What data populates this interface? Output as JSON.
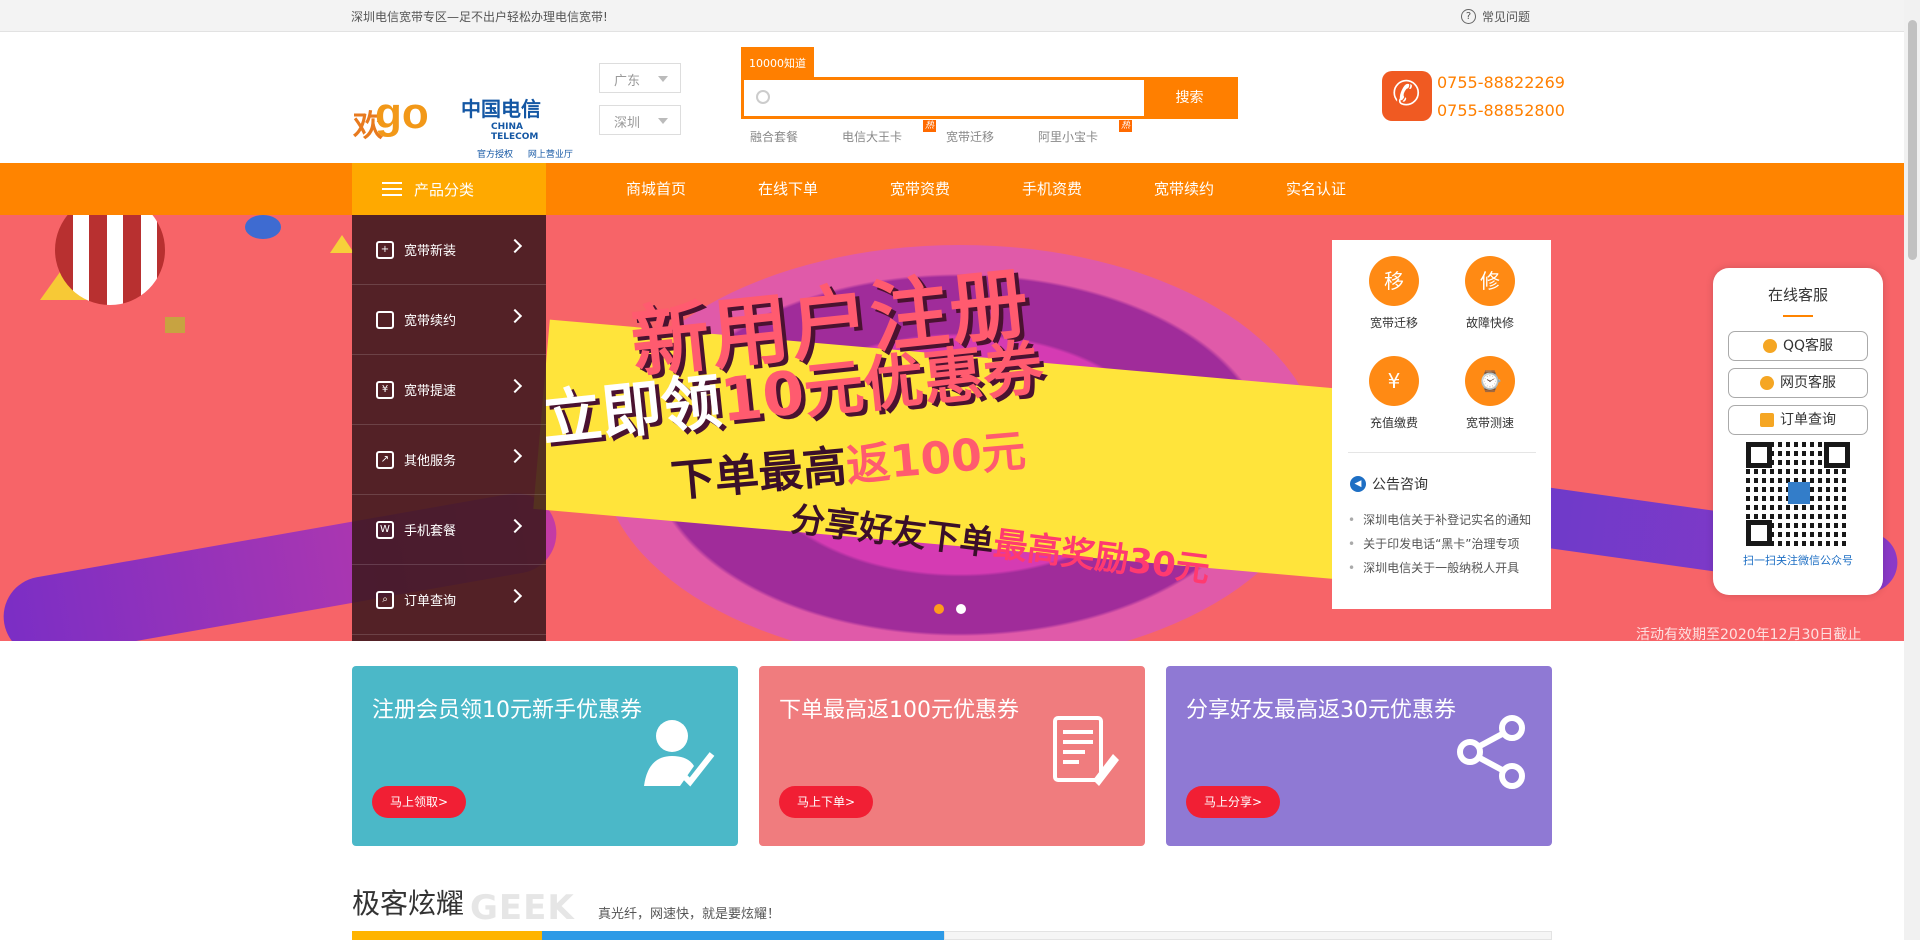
{
  "topbar": {
    "slogan": "深圳电信宽带专区—足不出户轻松办理电信宽带!",
    "faq": "常见问题"
  },
  "logo": {
    "huan": "欢",
    "go": "go",
    "brand_cn": "中国电信",
    "brand_en": "CHINA TELECOM",
    "sub": "官方授权 网上营业厅"
  },
  "location": {
    "province": "广东",
    "city": "深圳"
  },
  "search": {
    "tag": "10000知道",
    "placeholder": "",
    "button": "搜索",
    "hotlinks": [
      {
        "label": "融合套餐",
        "hot": ""
      },
      {
        "label": "电信大王卡",
        "hot": "热"
      },
      {
        "label": "宽带迁移",
        "hot": ""
      },
      {
        "label": "阿里小宝卡",
        "hot": "热"
      }
    ]
  },
  "contact": {
    "phone1": "0755-88822269",
    "phone2": "0755-88852800"
  },
  "nav": {
    "category": "产品分类",
    "links": [
      "商城首页",
      "在线下单",
      "宽带资费",
      "手机资费",
      "宽带续约",
      "实名认证"
    ]
  },
  "categories": [
    {
      "label": "宽带新装",
      "icon": "user-add-icon"
    },
    {
      "label": "宽带续约",
      "icon": "mobile-icon"
    },
    {
      "label": "宽带提速",
      "icon": "money-bag-icon"
    },
    {
      "label": "其他服务",
      "icon": "rocket-icon"
    },
    {
      "label": "手机套餐",
      "icon": "w-icon"
    },
    {
      "label": "订单查询",
      "icon": "order-search-icon"
    }
  ],
  "banner": {
    "line1": "新用户注册",
    "line2a": "立即领",
    "line2b": "10元优惠券",
    "line3a": "下单最高",
    "line3b": "返100元",
    "line4a": "分享好友下单",
    "line4b": "最高奖励30元",
    "validity": "活动有效期至2020年12月30日截止",
    "slide_count": 2,
    "active_slide": 1
  },
  "services": [
    {
      "glyph": "移",
      "label": "宽带迁移"
    },
    {
      "glyph": "修",
      "label": "故障快修"
    },
    {
      "glyph": "¥",
      "label": "充值缴费"
    },
    {
      "glyph": "⌚",
      "label": "宽带测速"
    }
  ],
  "notice": {
    "title": "公告咨询",
    "items": [
      "深圳电信关于补登记实名的通知",
      "关于印发电话“黑卡”治理专项",
      "深圳电信关于一般纳税人开具"
    ]
  },
  "online": {
    "title": "在线客服",
    "buttons": [
      "QQ客服",
      "网页客服",
      "订单查询"
    ],
    "qr_caption": "扫一扫关注微信公众号"
  },
  "cards": [
    {
      "title": "注册会员领10元新手优惠券",
      "button": "马上领取>",
      "color": "#4bb8c8",
      "icon": "user-check-icon"
    },
    {
      "title": "下单最高返100元优惠券",
      "button": "马上下单>",
      "color": "#f07c7e",
      "icon": "order-form-icon"
    },
    {
      "title": "分享好友最高返30元优惠券",
      "button": "马上分享>",
      "color": "#8f79d4",
      "icon": "share-icon"
    }
  ],
  "section": {
    "title": "极客炫耀",
    "geek": "GEEK",
    "subtitle": "真光纤，网速快，就是要炫耀！"
  }
}
